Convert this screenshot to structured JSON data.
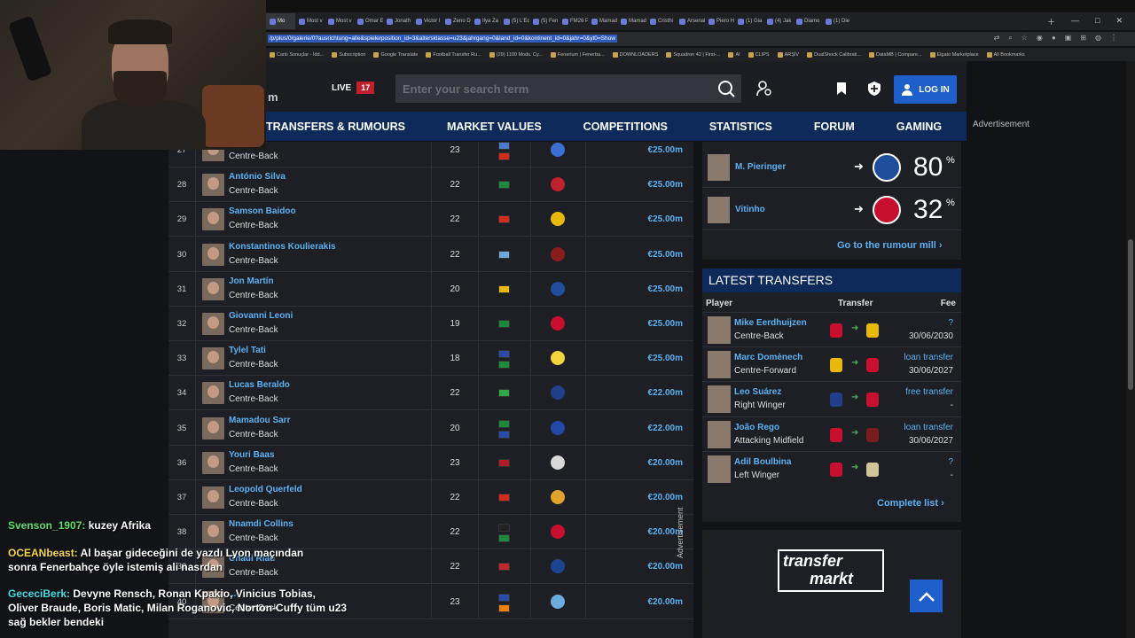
{
  "browser": {
    "tabs": [
      "Mo",
      "Most v",
      "Most v",
      "Omar E",
      "Jonath",
      "Victor I",
      "Zeno D",
      "Ilya Za",
      "(5) L'Eq",
      "(5) Fen",
      "FM26 P",
      "Mamadi",
      "Mamadi",
      "Cristhi",
      "Arsenal",
      "Piero H",
      "(1) Gia",
      "(4) Jak",
      "Diamo",
      "(1) Die"
    ],
    "url": "/p/plus/0/galerie/0?ausrichtung=alle&spielerposition_id=3&altersklasse=u23&jahrgang=0&land_id=0&kontinent_id=0&jahr=0&yt0=Show",
    "bookmarks": [
      "Canlı Sonuçlar - İdd...",
      "Subscription",
      "Google Translate",
      "Football Transfer Ru...",
      "(29) 1100 Mods. Cy...",
      "Fenerium | Fenerba...",
      "DOWNLOADERS",
      "Squadron 42 | First-...",
      "AI",
      "CLIPS",
      "ARŞİV",
      "DualShock Calibrati...",
      "DataMB | Compare...",
      "Elgato Marketplace",
      "All Bookmarks"
    ]
  },
  "header": {
    "logo_fragment": "m",
    "live_label": "LIVE",
    "live_count": "17",
    "search_placeholder": "Enter your search term",
    "login_label": "LOG IN"
  },
  "nav": [
    "TRANSFERS & RUMOURS",
    "MARKET VALUES",
    "COMPETITIONS",
    "STATISTICS",
    "FORUM",
    "GAMING"
  ],
  "ad_label": "Advertisement",
  "table_rows": [
    {
      "num": "27",
      "name": "...ıjdari",
      "pos": "Centre-Back",
      "age": "23",
      "value": "€25.00m",
      "flags": [
        "#4a7bd1",
        "#d52b1e"
      ],
      "club": "#3a6fd4"
    },
    {
      "num": "28",
      "name": "António Silva",
      "pos": "Centre-Back",
      "age": "22",
      "value": "€25.00m",
      "flags": [
        "#1c8a3a"
      ],
      "club": "#c0202c"
    },
    {
      "num": "29",
      "name": "Samson Baidoo",
      "pos": "Centre-Back",
      "age": "22",
      "value": "€25.00m",
      "flags": [
        "#d52b1e"
      ],
      "club": "#e8b90b"
    },
    {
      "num": "30",
      "name": "Konstantinos Koulierakis",
      "pos": "Centre-Back",
      "age": "22",
      "value": "€25.00m",
      "flags": [
        "#6fa8dc"
      ],
      "club": "#8b1c1c"
    },
    {
      "num": "31",
      "name": "Jon Martín",
      "pos": "Centre-Back",
      "age": "20",
      "value": "€25.00m",
      "flags": [
        "#e8b90b"
      ],
      "club": "#1f4f9c"
    },
    {
      "num": "32",
      "name": "Giovanni Leoni",
      "pos": "Centre-Back",
      "age": "19",
      "value": "€25.00m",
      "flags": [
        "#1c8a3a"
      ],
      "club": "#c8102e"
    },
    {
      "num": "33",
      "name": "Tylel Tati",
      "pos": "Centre-Back",
      "age": "18",
      "value": "€25.00m",
      "flags": [
        "#2a4ba8",
        "#1c8a3a"
      ],
      "club": "#f2d43a"
    },
    {
      "num": "34",
      "name": "Lucas Beraldo",
      "pos": "Centre-Back",
      "age": "22",
      "value": "€22.00m",
      "flags": [
        "#2fa84a"
      ],
      "club": "#1e3f8a"
    },
    {
      "num": "35",
      "name": "Mamadou Sarr",
      "pos": "Centre-Back",
      "age": "20",
      "value": "€22.00m",
      "flags": [
        "#1c8a3a",
        "#2a4ba8"
      ],
      "club": "#2148a5"
    },
    {
      "num": "36",
      "name": "Youri Baas",
      "pos": "Centre-Back",
      "age": "23",
      "value": "€20.00m",
      "flags": [
        "#ae1c28"
      ],
      "club": "#d8d8d8"
    },
    {
      "num": "37",
      "name": "Leopold Querfeld",
      "pos": "Centre-Back",
      "age": "22",
      "value": "€20.00m",
      "flags": [
        "#d52b1e"
      ],
      "club": "#e2a12b"
    },
    {
      "num": "38",
      "name": "Nnamdi Collins",
      "pos": "Centre-Back",
      "age": "22",
      "value": "€20.00m",
      "flags": [
        "#222222",
        "#1c8a3a"
      ],
      "club": "#c8102e"
    },
    {
      "num": "39",
      "name": "Chadi Riad",
      "pos": "Centre-Back",
      "age": "22",
      "value": "€20.00m",
      "flags": [
        "#c1272d"
      ],
      "club": "#1b458f"
    },
    {
      "num": "40",
      "name": "...",
      "pos": "Centre-Back",
      "age": "23",
      "value": "€20.00m",
      "flags": [
        "#2a4ba8",
        "#f77f00"
      ],
      "club": "#6cabdd"
    }
  ],
  "rumours": [
    {
      "name": "M. Pieringer",
      "pct": "80",
      "club": "#1f4f9c",
      "pct_sign": "%"
    },
    {
      "name": "Vitinho",
      "pct": "32",
      "club": "#c8102e",
      "pct_sign": "%"
    }
  ],
  "rumour_link": "Go to the rumour mill",
  "latest": {
    "title": "LATEST TRANSFERS",
    "headers": {
      "player": "Player",
      "transfer": "Transfer",
      "fee": "Fee"
    },
    "rows": [
      {
        "name": "Mike Eerdhuijzen",
        "pos": "Centre-Back",
        "fee": "?",
        "date": "30/06/2030",
        "c1": "#c8102e",
        "c2": "#e8b90b"
      },
      {
        "name": "Marc Domènech",
        "pos": "Centre-Forward",
        "fee": "loan transfer",
        "date": "30/06/2027",
        "c1": "#e8b90b",
        "c2": "#c8102e"
      },
      {
        "name": "Leo Suárez",
        "pos": "Right Winger",
        "fee": "free transfer",
        "date": "-",
        "c1": "#1f3f8a",
        "c2": "#c8102e"
      },
      {
        "name": "João Rego",
        "pos": "Attacking Midfield",
        "fee": "loan transfer",
        "date": "30/06/2027",
        "c1": "#c8102e",
        "c2": "#7a1c1c"
      },
      {
        "name": "Adil Boulbina",
        "pos": "Left Winger",
        "fee": "?",
        "date": "-",
        "c1": "#c8102e",
        "c2": "#d4c49a"
      }
    ],
    "complete_link": "Complete list"
  },
  "ad_vertical": "Advertisement",
  "logo_text": {
    "line1": "transfer",
    "line2": "markt"
  },
  "chat": [
    {
      "user": "Svenson_1907:",
      "msg": "kuzey Afrika"
    },
    {
      "user": "OCEANbeast:",
      "msg": "Al başar gideceğini de yazdı Lyon maçından sonra Fenerbahçe öyle istemiş ali nasrdan"
    },
    {
      "user": "GececiBerk:",
      "msg": "Devyne Rensch, Ronan Kpakio, Vinicius Tobias, Oliver Braude, Boris Matic, Milan Roganovic, Norton-Cuffy tüm u23 sağ bekler bendeki"
    }
  ]
}
